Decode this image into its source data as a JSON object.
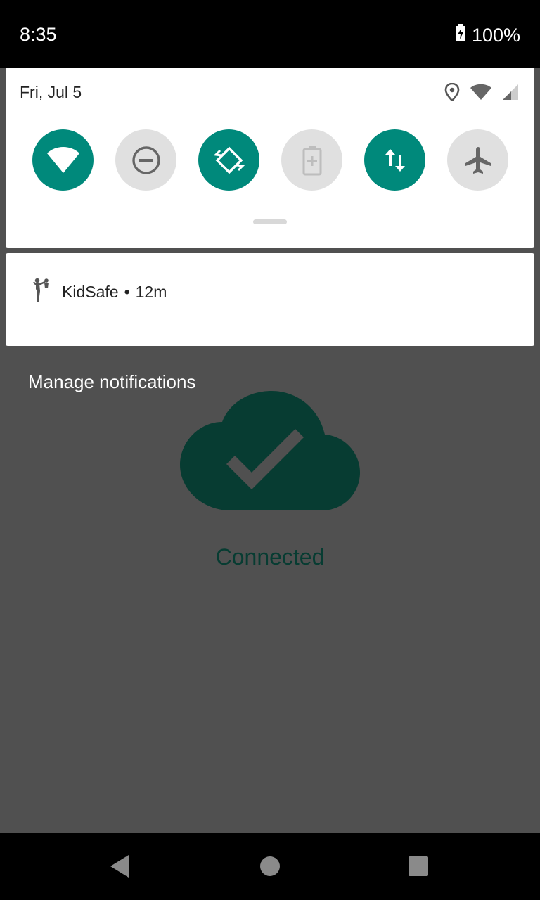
{
  "status_bar": {
    "time": "8:35",
    "battery_percent": "100%",
    "icons": [
      "battery-charging-icon"
    ]
  },
  "quick_settings": {
    "date": "Fri, Jul 5",
    "status_icons": [
      "location-icon",
      "wifi-icon",
      "cellular-signal-icon"
    ],
    "tiles": [
      {
        "name": "wifi",
        "icon": "wifi-icon",
        "state": "on"
      },
      {
        "name": "do-not-disturb",
        "icon": "do-not-disturb-icon",
        "state": "off"
      },
      {
        "name": "auto-rotate",
        "icon": "auto-rotate-icon",
        "state": "on"
      },
      {
        "name": "battery-saver",
        "icon": "battery-saver-icon",
        "state": "disabled"
      },
      {
        "name": "mobile-data",
        "icon": "mobile-data-icon",
        "state": "on"
      },
      {
        "name": "airplane-mode",
        "icon": "airplane-icon",
        "state": "off"
      }
    ]
  },
  "notification": {
    "app_name": "KidSafe",
    "separator": "•",
    "time_ago": "12m",
    "icon": "kidsafe-app-icon"
  },
  "manage_label": "Manage notifications",
  "app_background": {
    "status_text": "Connected",
    "icon": "cloud-check-icon"
  },
  "colors": {
    "accent": "#00897b",
    "scrim": "#505050",
    "connected_text": "#073c32",
    "cloud": "#073c32"
  },
  "nav_bar": {
    "buttons": [
      "back-icon",
      "home-icon",
      "recents-icon"
    ]
  }
}
